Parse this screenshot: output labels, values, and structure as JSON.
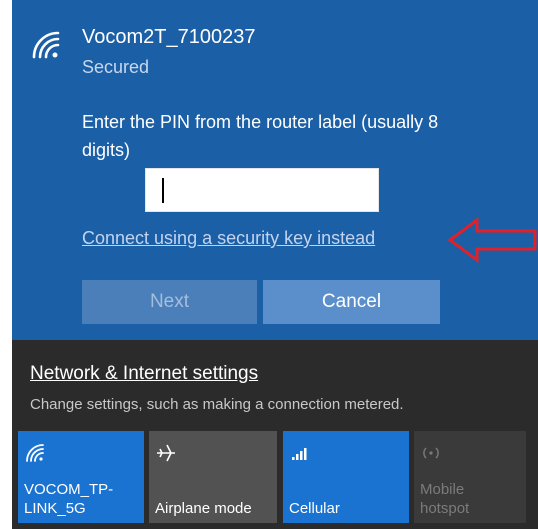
{
  "network": {
    "name": "Vocom2T_7100237",
    "status": "Secured"
  },
  "pin_prompt": {
    "text": "Enter the PIN from the router label (usually 8 digits)",
    "input_value": ""
  },
  "alt_link": "Connect using a security key instead",
  "buttons": {
    "next": "Next",
    "cancel": "Cancel"
  },
  "settings": {
    "link": "Network & Internet settings",
    "description": "Change settings, such as making a connection metered."
  },
  "tiles": [
    {
      "label": "VOCOM_TP-LINK_5G",
      "icon": "wifi-icon",
      "active": true
    },
    {
      "label": "Airplane mode",
      "icon": "airplane-icon",
      "active": false
    },
    {
      "label": "Cellular",
      "icon": "cellular-icon",
      "active": true
    },
    {
      "label": "Mobile hotspot",
      "icon": "hotspot-icon",
      "active": false,
      "disabled": true
    }
  ],
  "colors": {
    "accent": "#1a73d0",
    "panel_blue": "#1b5fa7",
    "panel_dark": "#2b2b2b",
    "annotation_arrow": "#e0212a"
  }
}
